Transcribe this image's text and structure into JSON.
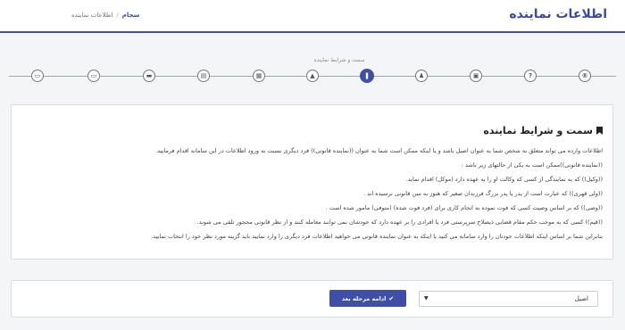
{
  "header": {
    "title": "اطلاعات نماینده",
    "breadcrumb": {
      "home": "سجام",
      "separator": "/",
      "current": "اطلاعات نماینده"
    }
  },
  "stepper": {
    "active_label": "سمت و شرایط نماینده",
    "steps": [
      {
        "icon": "registered-icon",
        "glyph": "®"
      },
      {
        "icon": "question-icon",
        "glyph": "?"
      },
      {
        "icon": "id-card-icon",
        "glyph": "▣"
      },
      {
        "icon": "person-icon",
        "glyph": "♟"
      },
      {
        "icon": "bookmark-icon",
        "glyph": "❚"
      },
      {
        "icon": "graduation-cap-icon",
        "glyph": "▲"
      },
      {
        "icon": "building-icon",
        "glyph": "▦"
      },
      {
        "icon": "table-icon",
        "glyph": "▤"
      },
      {
        "icon": "briefcase-icon",
        "glyph": "▬"
      },
      {
        "icon": "money-icon",
        "glyph": "▭"
      },
      {
        "icon": "credit-card-icon",
        "glyph": "▭"
      },
      {
        "icon": "document-icon",
        "glyph": "▯"
      }
    ]
  },
  "panel": {
    "title": "سمت و شرایط نماینده",
    "lines": [
      "اطلاعات وارده می تواند متعلق به شخص شما به عنوان اصیل باشد و یا اینکه ممکن است شما به عنوان ((نماینده قانونی)) فرد دیگری نسبت به ورود اطلاعات در این سامانه اقدام فرمایید.",
      "((نماینده قانونی))ممکن است به یکی از حالتهای زیر باشد :",
      "((وکیل)) که به نمایندگی از کسی که وکالت او را به عهده دارد (موکل) اقدام نماید.",
      "((ولی قهری)) که عبارت است از پدر یا پدر بزرگ فرزندان صغیر که هنوز به سن قانونی نرسیده اند .",
      "((وصی)) که بر اساس وصیت کسی که فوت نموده به انجام کاری برای (فرد فوت شده) (متوفی) مامور شده است .",
      "((قیم)) کسی که به موجب حکم مقام قضایی ذیصلاح سرپرستی فرد یا افرادی را بر عهده دارد که خودشان نمی توانند معامله کنند و از نظر قانونی محجور تلقی می شوند.",
      "بنابراین شما بر اساس اینکه اطلاعات خودتان را وارد سامانه می کنید یا اینکه به عنوان نماینده قانونی می خواهید اطلاعات فرد دیگری را وارد نمایید باید گزینه مورد نظر خود را انتخاب نمایید."
    ]
  },
  "footer": {
    "select_value": "اصیل",
    "next_button": "ادامه مرحله بعد"
  },
  "colors": {
    "accent": "#3f4fa8"
  }
}
